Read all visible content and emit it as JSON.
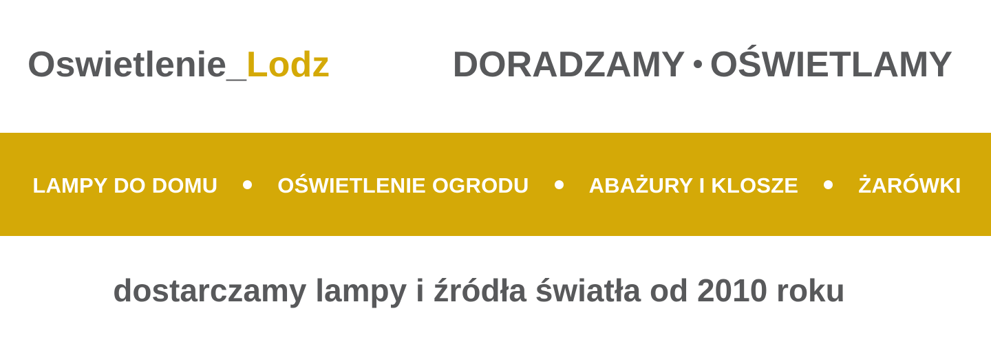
{
  "header": {
    "logo_main": "Oswietlenie_",
    "logo_accent": "Lodz",
    "tagline_left": "DORADZAMY",
    "tagline_right": "OŚWIETLAMY"
  },
  "nav": {
    "items": [
      {
        "label": "LAMPY DO DOMU"
      },
      {
        "label": "OŚWIETLENIE OGRODU"
      },
      {
        "label": "ABAŻURY I KLOSZE"
      },
      {
        "label": "ŻARÓWKI"
      }
    ]
  },
  "slogan": "dostarczamy lampy i źródła światła od 2010 roku",
  "colors": {
    "accent": "#d4a907",
    "text": "#58595b",
    "nav_text": "#ffffff",
    "background": "#ffffff"
  }
}
